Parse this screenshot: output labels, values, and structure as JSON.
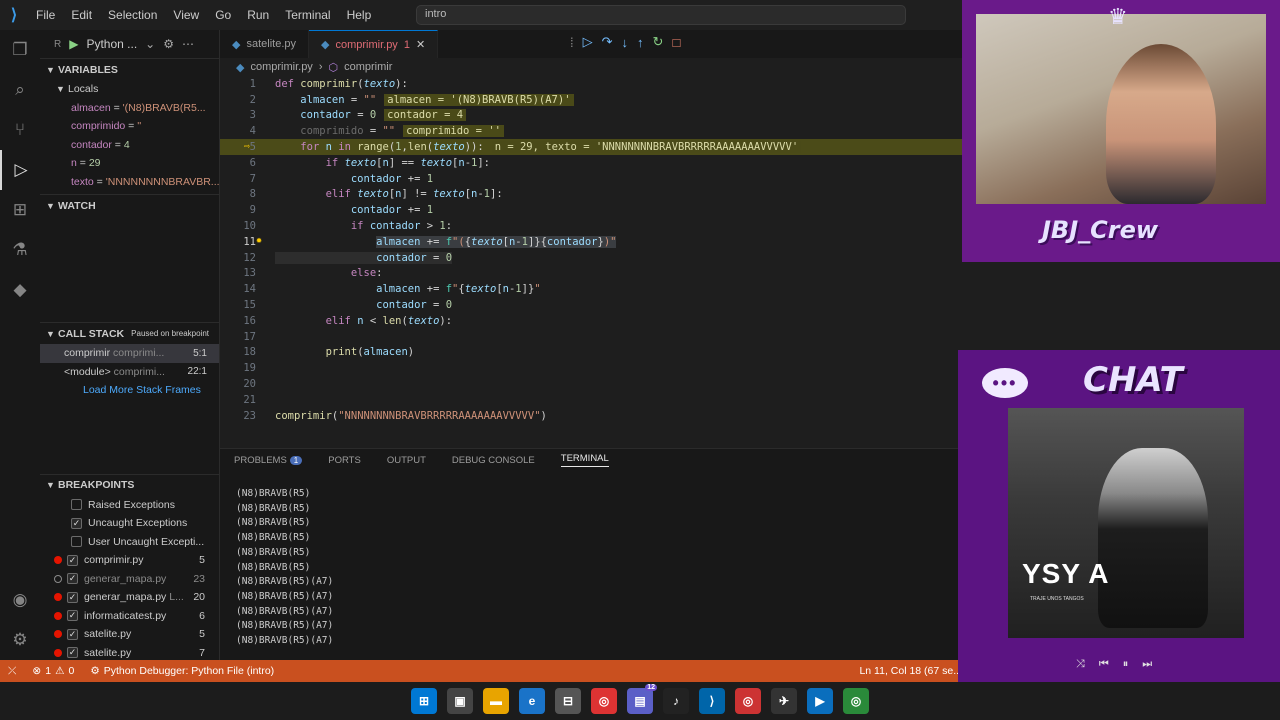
{
  "titlebar": {
    "menus": [
      "File",
      "Edit",
      "Selection",
      "View",
      "Go",
      "Run",
      "Terminal",
      "Help"
    ],
    "search_text": "intro"
  },
  "sidebar": {
    "run_config": "Python ...",
    "variables_title": "VARIABLES",
    "locals_title": "Locals",
    "locals": [
      {
        "name": "almacen",
        "value": "'(N8)BRAVB(R5..."
      },
      {
        "name": "comprimido",
        "value": "''"
      },
      {
        "name": "contador",
        "value": "4"
      },
      {
        "name": "n",
        "value": "29"
      },
      {
        "name": "texto",
        "value": "'NNNNNNNNBRAVBR..."
      }
    ],
    "watch_title": "WATCH",
    "callstack_title": "CALL STACK",
    "callstack_status": "Paused on breakpoint",
    "frames": [
      {
        "fn": "comprimir",
        "file": "comprimi...",
        "pos": "5:1"
      },
      {
        "fn": "<module>",
        "file": "comprimi...",
        "pos": "22:1"
      }
    ],
    "load_more": "Load More Stack Frames",
    "breakpoints_title": "BREAKPOINTS",
    "exception_bps": [
      {
        "label": "Raised Exceptions",
        "checked": false
      },
      {
        "label": "Uncaught Exceptions",
        "checked": true
      },
      {
        "label": "User Uncaught Excepti...",
        "checked": false
      }
    ],
    "file_bps": [
      {
        "file": "comprimir.py",
        "line": "5",
        "enabled": true,
        "extra": ""
      },
      {
        "file": "generar_mapa.py",
        "line": "23",
        "enabled": false,
        "extra": ""
      },
      {
        "file": "generar_mapa.py",
        "line": "20",
        "enabled": true,
        "extra": "L..."
      },
      {
        "file": "informaticatest.py",
        "line": "6",
        "enabled": true,
        "extra": ""
      },
      {
        "file": "satelite.py",
        "line": "5",
        "enabled": true,
        "extra": ""
      },
      {
        "file": "satelite.py",
        "line": "7",
        "enabled": true,
        "extra": ""
      }
    ]
  },
  "tabs": [
    {
      "label": "satelite.py",
      "active": false,
      "badge": ""
    },
    {
      "label": "comprimir.py",
      "active": true,
      "badge": "1"
    }
  ],
  "breadcrumb": {
    "file": "comprimir.py",
    "symbol": "comprimir"
  },
  "editor": {
    "inline_values": {
      "almacen": "almacen = '(N8)BRAVB(R5)(A7)'",
      "contador": "contador = 4",
      "comprimido": "comprimido = ''",
      "loop": "n = 29, texto = 'NNNNNNNNBRAVBRRRRRAAAAAAAVVVVV'"
    },
    "call_arg": "\"NNNNNNNNBRAVBRRRRRAAAAAAAVVVVV\""
  },
  "panel": {
    "tabs": [
      "PROBLEMS",
      "PORTS",
      "OUTPUT",
      "DEBUG CONSOLE",
      "TERMINAL"
    ],
    "problems_count": "1",
    "terminal_lines": [
      "(N8)BRAVB(R5)",
      "(N8)BRAVB(R5)",
      "(N8)BRAVB(R5)",
      "(N8)BRAVB(R5)",
      "(N8)BRAVB(R5)",
      "(N8)BRAVB(R5)",
      "(N8)BRAVB(R5)(A7)",
      "(N8)BRAVB(R5)(A7)",
      "(N8)BRAVB(R5)(A7)",
      "(N8)BRAVB(R5)(A7)",
      "(N8)BRAVB(R5)(A7)"
    ]
  },
  "statusbar": {
    "errors": "1",
    "warnings": "0",
    "debugger": "Python Debugger: Python File (intro)",
    "position": "Ln 11, Col 18 (67 se..."
  },
  "overlay": {
    "crew_label": "JBJ_Crew",
    "chat_label": "CHAT",
    "video_title": "YSY A",
    "video_subtitle": "TRAJE UNOS TANGOS"
  },
  "taskbar": {
    "notification_count": "12"
  },
  "colors": {
    "accent": "#0078d4",
    "statusbar": "#c9501f",
    "overlay": "#5b1482"
  }
}
